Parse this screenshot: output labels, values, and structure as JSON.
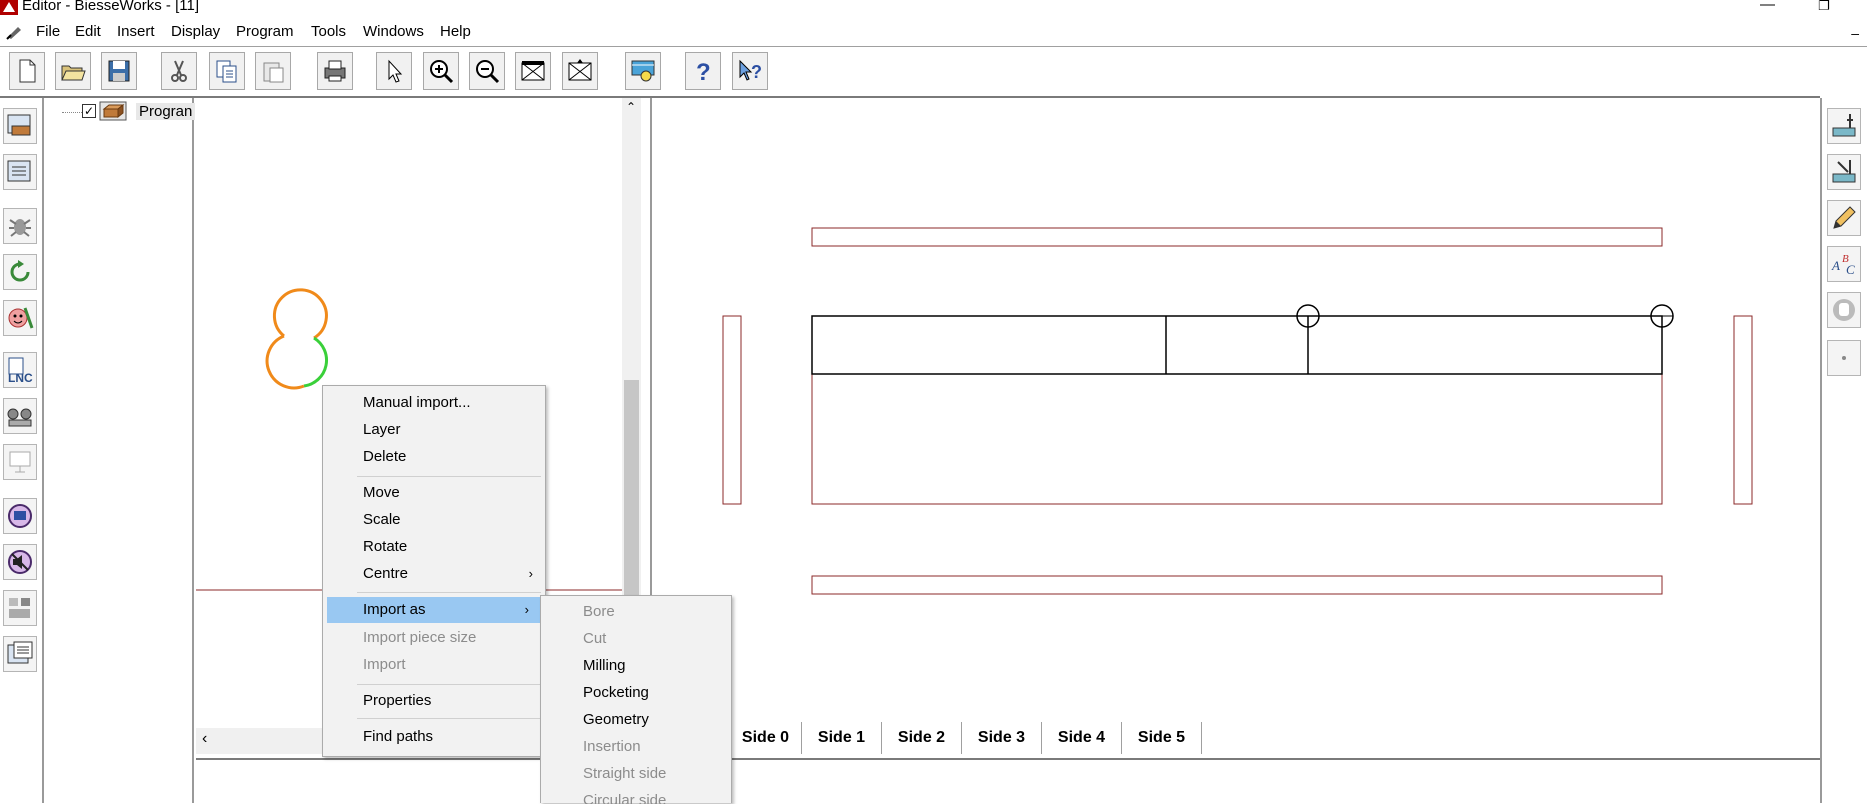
{
  "window": {
    "title": "Editor - BiesseWorks - [11]"
  },
  "menubar": [
    "File",
    "Edit",
    "Insert",
    "Display",
    "Program",
    "Tools",
    "Windows",
    "Help"
  ],
  "toolbar": [
    "new-icon",
    "open-icon",
    "save-icon",
    "cut-icon",
    "copy-icon",
    "paste-icon",
    "print-icon",
    "select-icon",
    "zoom-in-icon",
    "zoom-out-icon",
    "zoom-window-icon",
    "zoom-all-icon",
    "view-icon",
    "help-icon",
    "context-help-icon"
  ],
  "tree": {
    "root_label": "Progran"
  },
  "context_menu": {
    "items": [
      {
        "label": "Manual import...",
        "enabled": true
      },
      {
        "label": "Layer",
        "enabled": true
      },
      {
        "label": "Delete",
        "enabled": true
      },
      {
        "label": "Move",
        "enabled": true
      },
      {
        "label": "Scale",
        "enabled": true
      },
      {
        "label": "Rotate",
        "enabled": true
      },
      {
        "label": "Centre",
        "enabled": true,
        "submenu": true
      },
      {
        "label": "Import as",
        "enabled": true,
        "submenu": true,
        "highlighted": true
      },
      {
        "label": "Import piece size",
        "enabled": false
      },
      {
        "label": "Import",
        "enabled": false
      },
      {
        "label": "Properties",
        "enabled": true
      },
      {
        "label": "Find paths",
        "enabled": true
      }
    ]
  },
  "import_as_submenu": {
    "items": [
      {
        "label": "Bore",
        "enabled": false
      },
      {
        "label": "Cut",
        "enabled": false
      },
      {
        "label": "Milling",
        "enabled": true
      },
      {
        "label": "Pocketing",
        "enabled": true
      },
      {
        "label": "Geometry",
        "enabled": true
      },
      {
        "label": "Insertion",
        "enabled": false
      },
      {
        "label": "Straight side",
        "enabled": false
      },
      {
        "label": "Circular side",
        "enabled": false
      }
    ]
  },
  "side_tabs": [
    "Side 0",
    "Side 1",
    "Side 2",
    "Side 3",
    "Side 4",
    "Side 5"
  ],
  "colors": {
    "piece_outline": "#8b2a2a",
    "menu_highlight": "#99c8f2",
    "disabled_text": "#8c8c8c"
  }
}
